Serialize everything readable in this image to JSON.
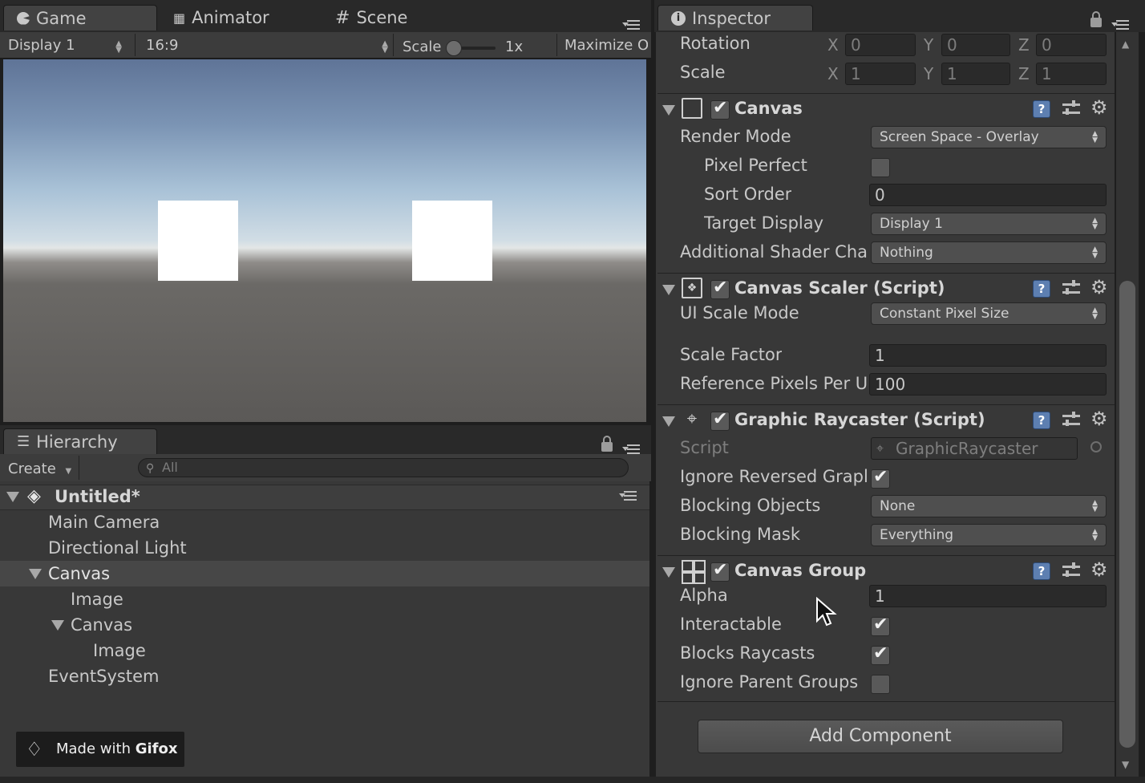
{
  "tabs": {
    "game": "Game",
    "animator": "Animator",
    "scene": "Scene",
    "inspector": "Inspector",
    "hierarchy": "Hierarchy"
  },
  "game_toolbar": {
    "display": "Display 1",
    "aspect": "16:9",
    "scale_label": "Scale",
    "scale_value": "1x",
    "maximize": "Maximize O"
  },
  "hierarchy": {
    "create_label": "Create",
    "search_placeholder": "All",
    "scene_name": "Untitled*",
    "items": [
      {
        "label": "Main Camera"
      },
      {
        "label": "Directional Light"
      },
      {
        "label": "Canvas"
      },
      {
        "label": "Image"
      },
      {
        "label": "Canvas"
      },
      {
        "label": "Image"
      },
      {
        "label": "EventSystem"
      }
    ]
  },
  "transform": {
    "rotation_label": "Rotation",
    "rotation": {
      "x": "0",
      "y": "0",
      "z": "0"
    },
    "scale_label": "Scale",
    "scale": {
      "x": "1",
      "y": "1",
      "z": "1"
    },
    "axis": {
      "x": "X",
      "y": "Y",
      "z": "Z"
    }
  },
  "canvas": {
    "title": "Canvas",
    "render_mode_label": "Render Mode",
    "render_mode": "Screen Space - Overlay",
    "pixel_perfect_label": "Pixel Perfect",
    "sort_order_label": "Sort Order",
    "sort_order": "0",
    "target_display_label": "Target Display",
    "target_display": "Display 1",
    "shader_channels_label": "Additional Shader Cha",
    "shader_channels": "Nothing"
  },
  "canvas_scaler": {
    "title": "Canvas Scaler (Script)",
    "ui_scale_mode_label": "UI Scale Mode",
    "ui_scale_mode": "Constant Pixel Size",
    "scale_factor_label": "Scale Factor",
    "scale_factor": "1",
    "ref_ppu_label": "Reference Pixels Per U",
    "ref_ppu": "100"
  },
  "graphic_raycaster": {
    "title": "Graphic Raycaster (Script)",
    "script_label": "Script",
    "script_value": "GraphicRaycaster",
    "ignore_reversed_label": "Ignore Reversed Grapl",
    "blocking_objects_label": "Blocking Objects",
    "blocking_objects": "None",
    "blocking_mask_label": "Blocking Mask",
    "blocking_mask": "Everything"
  },
  "canvas_group": {
    "title": "Canvas Group",
    "alpha_label": "Alpha",
    "alpha": "1",
    "interactable_label": "Interactable",
    "blocks_raycasts_label": "Blocks Raycasts",
    "ignore_parent_label": "Ignore Parent Groups"
  },
  "add_component": "Add Component",
  "watermark": {
    "prefix": "Made with ",
    "brand": "Gifox"
  },
  "colors": {
    "panel_bg": "#383838",
    "sky_top": "#5f7497",
    "ground": "#5b5957",
    "selection": "#474747"
  }
}
